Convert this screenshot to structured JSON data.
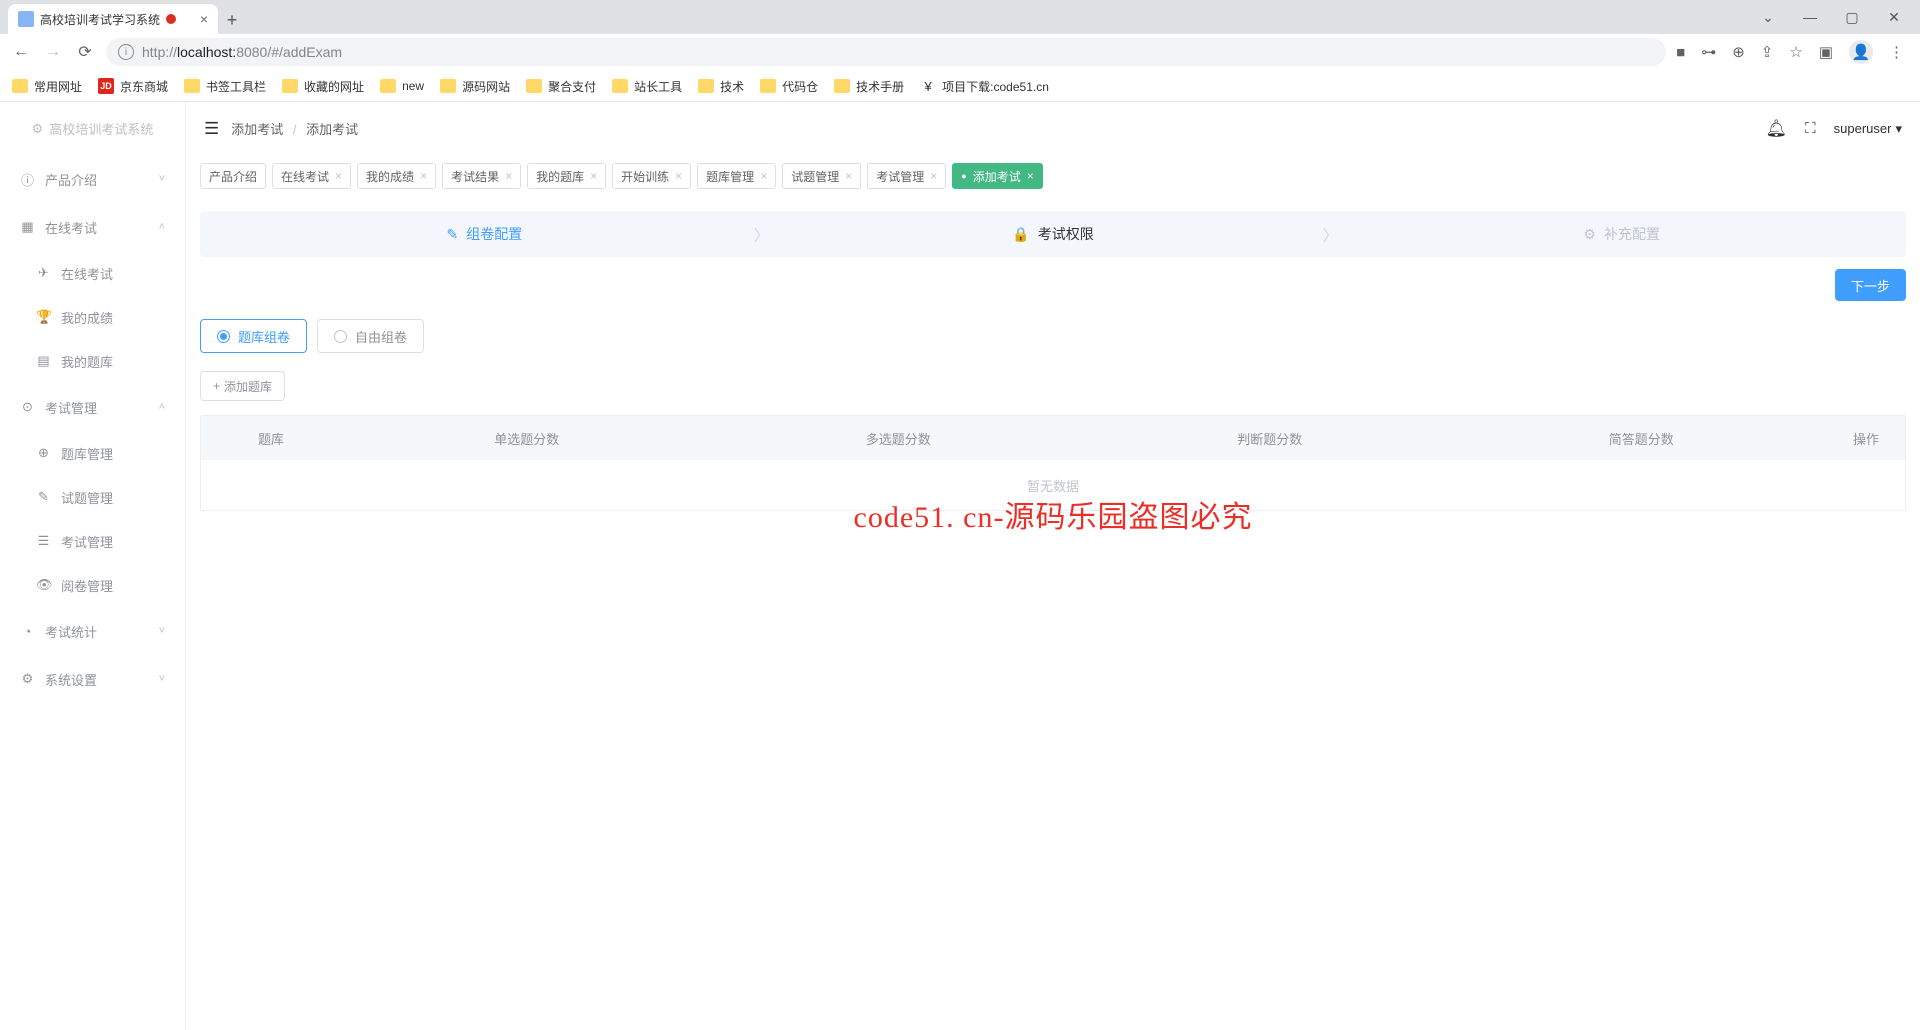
{
  "browser": {
    "tab_title": "高校培训考试学习系统",
    "url_host": "localhost:",
    "url_port": "8080",
    "url_path": "/#/addExam",
    "url_scheme": "http://"
  },
  "bookmarks": [
    {
      "type": "folder",
      "label": "常用网址"
    },
    {
      "type": "jd",
      "label": "京东商城"
    },
    {
      "type": "folder",
      "label": "书签工具栏"
    },
    {
      "type": "folder",
      "label": "收藏的网址"
    },
    {
      "type": "folder",
      "label": "new"
    },
    {
      "type": "folder",
      "label": "源码网站"
    },
    {
      "type": "folder",
      "label": "聚合支付"
    },
    {
      "type": "folder",
      "label": "站长工具"
    },
    {
      "type": "folder",
      "label": "技术"
    },
    {
      "type": "folder",
      "label": "代码仓"
    },
    {
      "type": "folder",
      "label": "技术手册"
    },
    {
      "type": "code51",
      "label": "项目下载:code51.cn"
    }
  ],
  "brand": "高校培训考试系统",
  "sidebar": {
    "items": [
      {
        "label": "产品介绍",
        "icon": "ⓘ",
        "sub": []
      },
      {
        "label": "在线考试",
        "icon": "▦",
        "expanded": true,
        "sub": [
          {
            "label": "在线考试",
            "icon": "✈"
          },
          {
            "label": "我的成绩",
            "icon": "🏆"
          },
          {
            "label": "我的题库",
            "icon": "▤"
          }
        ]
      },
      {
        "label": "考试管理",
        "icon": "⊙",
        "expanded": true,
        "sub": [
          {
            "label": "题库管理",
            "icon": "⊕"
          },
          {
            "label": "试题管理",
            "icon": "✎"
          },
          {
            "label": "考试管理",
            "icon": "☰"
          },
          {
            "label": "阅卷管理",
            "icon": "👁"
          }
        ]
      },
      {
        "label": "考试统计",
        "icon": "◔",
        "sub": []
      },
      {
        "label": "系统设置",
        "icon": "⚙",
        "sub": []
      }
    ]
  },
  "breadcrumb": {
    "a": "添加考试",
    "b": "添加考试"
  },
  "user": "superuser",
  "app_tabs": [
    {
      "label": "产品介绍",
      "closable": false
    },
    {
      "label": "在线考试",
      "closable": true
    },
    {
      "label": "我的成绩",
      "closable": true
    },
    {
      "label": "考试结果",
      "closable": true
    },
    {
      "label": "我的题库",
      "closable": true
    },
    {
      "label": "开始训练",
      "closable": true
    },
    {
      "label": "题库管理",
      "closable": true
    },
    {
      "label": "试题管理",
      "closable": true
    },
    {
      "label": "考试管理",
      "closable": true
    },
    {
      "label": "添加考试",
      "closable": true,
      "active": true
    }
  ],
  "steps": [
    {
      "label": "组卷配置",
      "icon": "✎",
      "state": "active"
    },
    {
      "label": "考试权限",
      "icon": "🔒",
      "state": "process"
    },
    {
      "label": "补充配置",
      "icon": "⚙",
      "state": "wait"
    }
  ],
  "buttons": {
    "next": "下一步",
    "add_bank": "添加题库"
  },
  "radios": [
    {
      "label": "题库组卷",
      "checked": true
    },
    {
      "label": "自由组卷",
      "checked": false
    }
  ],
  "table": {
    "cols": [
      "题库",
      "单选题分数",
      "多选题分数",
      "判断题分数",
      "简答题分数",
      "操作"
    ],
    "empty": "暂无数据"
  },
  "watermark": "code51. cn-源码乐园盗图必究"
}
